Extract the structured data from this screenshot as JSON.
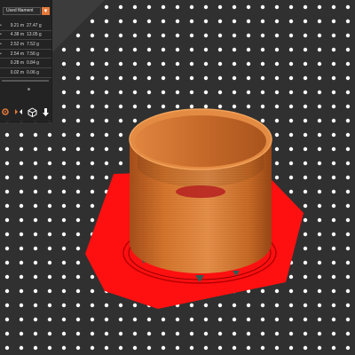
{
  "stats_panel": {
    "column_title": "Used filament",
    "dropdown_icon": "triangle-down-icon",
    "rows": [
      {
        "marker": "•",
        "length": "9.21 m",
        "weight": "27.47 g"
      },
      {
        "marker": "•",
        "length": "4.38 m",
        "weight": "13.05 g"
      },
      {
        "marker": "•",
        "length": "2.52 m",
        "weight": "7.52 g"
      },
      {
        "marker": "•",
        "length": "2.54 m",
        "weight": "7.56 g"
      },
      {
        "marker": "",
        "length": "0.28 m",
        "weight": "0.84 g"
      },
      {
        "marker": "",
        "length": "0.02 m",
        "weight": "0.06 g"
      }
    ]
  },
  "toolbar": {
    "icons": [
      "settings-icon",
      "mirror-icon",
      "cube-view-icon",
      "export-icon"
    ]
  },
  "colors": {
    "bed_surface": "#333333",
    "bed_dots": "#ffffff",
    "brim_red": "#ff1010",
    "model_orange": "#d8772d",
    "panel_bg": "#222222",
    "accent": "#e3793b"
  }
}
